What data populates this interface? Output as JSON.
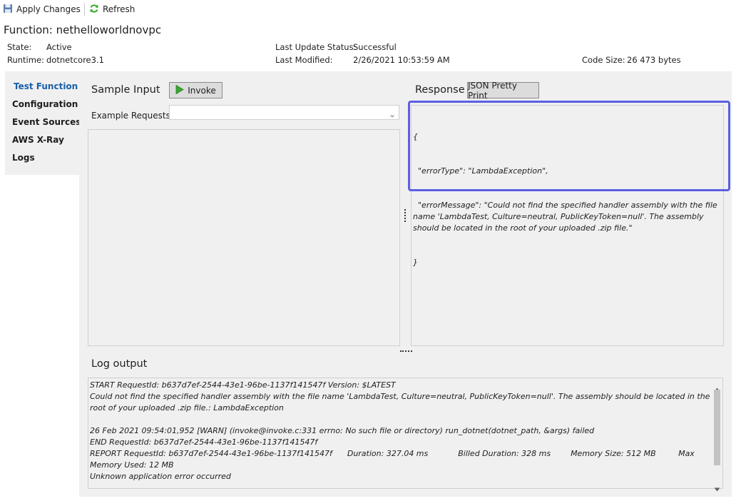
{
  "toolbar": {
    "apply_label": "Apply Changes",
    "refresh_label": "Refresh"
  },
  "function": {
    "title": "Function: nethelloworldnovpc",
    "state_label": "State:",
    "state_value": "Active",
    "runtime_label": "Runtime:",
    "runtime_value": "dotnetcore3.1",
    "update_status_label": "Last Update Status:",
    "update_status_value": "Successful",
    "modified_label": "Last Modified:",
    "modified_value": "2/26/2021 10:53:59 AM",
    "code_size_label": "Code Size:",
    "code_size_value": "26 473 bytes"
  },
  "nav": {
    "items": [
      {
        "label": "Test Function",
        "active": true
      },
      {
        "label": "Configuration",
        "active": false
      },
      {
        "label": "Event Sources",
        "active": false
      },
      {
        "label": "AWS X-Ray",
        "active": false
      },
      {
        "label": "Logs",
        "active": false
      }
    ]
  },
  "sample_input": {
    "heading": "Sample Input",
    "invoke_label": "Invoke",
    "example_label": "Example Requests:",
    "example_value": ""
  },
  "response": {
    "heading": "Response",
    "pretty_print_label": "JSON Pretty Print",
    "lines": [
      "{",
      "  \"errorType\": \"LambdaException\",",
      "  \"errorMessage\": \"Could not find the specified handler assembly with the file name 'LambdaTest, Culture=neutral, PublicKeyToken=null'. The assembly should be located in the root of your uploaded .zip file.\"",
      "}"
    ]
  },
  "log": {
    "heading": "Log output",
    "lines": [
      "START RequestId: b637d7ef-2544-43e1-96be-1137f141547f Version: $LATEST",
      "Could not find the specified handler assembly with the file name 'LambdaTest, Culture=neutral, PublicKeyToken=null'. The assembly should be located in the root of your uploaded .zip file.: LambdaException",
      "",
      "26 Feb 2021 09:54:01,952 [WARN] (invoke@invoke.c:331 errno: No such file or directory) run_dotnet(dotnet_path, &args) failed",
      "END RequestId: b637d7ef-2544-43e1-96be-1137f141547f",
      "REPORT RequestId: b637d7ef-2544-43e1-96be-1137f141547f      Duration: 327.04 ms            Billed Duration: 328 ms        Memory Size: 512 MB         Max Memory Used: 12 MB",
      "Unknown application error occurred"
    ]
  },
  "colors": {
    "active_nav": "#1a5fa8",
    "highlight": "#5b5fe0",
    "invoke_icon": "#3aa830",
    "refresh_icon": "#3aa830"
  }
}
